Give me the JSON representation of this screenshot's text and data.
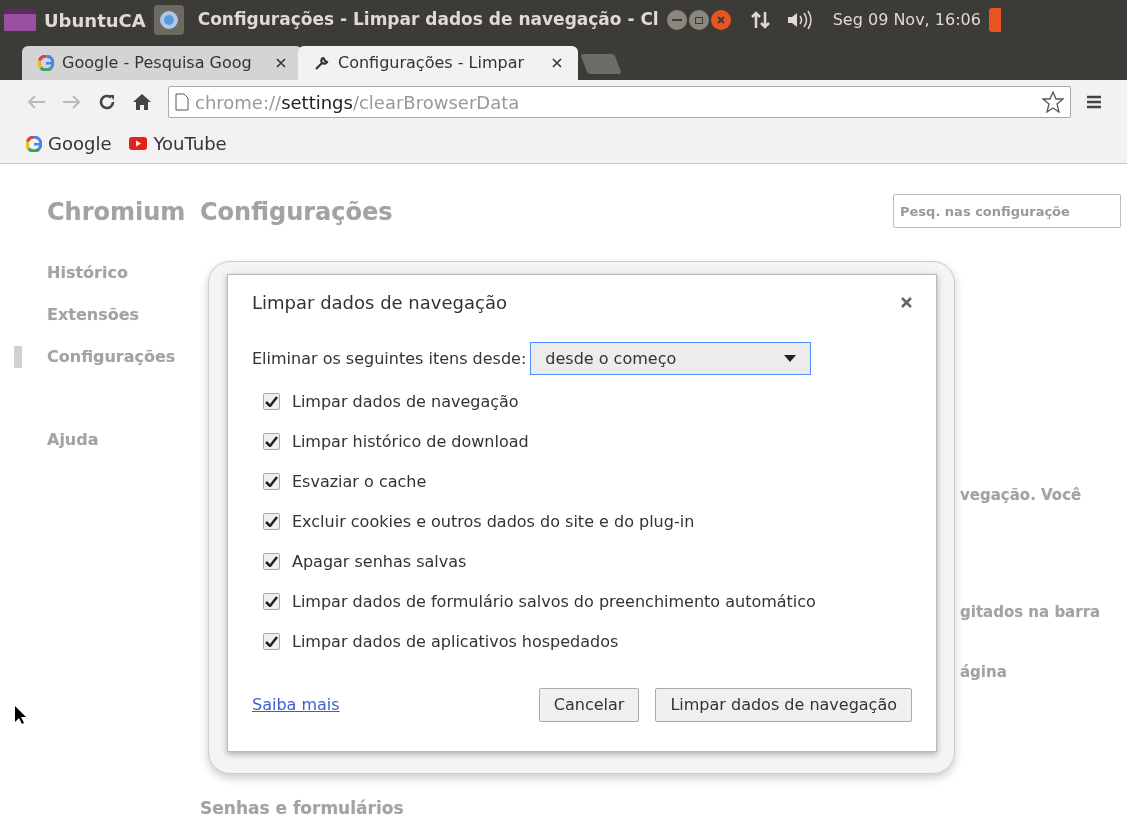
{
  "top_panel": {
    "app_name": "UbuntuCA",
    "window_title": "Configurações - Limpar dados de navegação - Cl",
    "clock": "Seg 09 Nov, 16:06"
  },
  "tabs": [
    {
      "label": "Google - Pesquisa Goog",
      "selected": false,
      "kind": "google"
    },
    {
      "label": "Configurações - Limpar",
      "selected": true,
      "kind": "settings"
    }
  ],
  "address_bar": {
    "scheme": "chrome://",
    "host": "settings",
    "path": "/clearBrowserData"
  },
  "bookmarks": [
    {
      "label": "Google",
      "kind": "google"
    },
    {
      "label": "YouTube",
      "kind": "youtube"
    }
  ],
  "sidebar": {
    "title": "Chromium",
    "items": [
      {
        "label": "Histórico",
        "selected": false
      },
      {
        "label": "Extensões",
        "selected": false
      },
      {
        "label": "Configurações",
        "selected": true
      }
    ],
    "help_item": "Ajuda"
  },
  "page": {
    "title": "Configurações",
    "search": {
      "placeholder": "Pesq. nas configuraçõe"
    },
    "fragments": [
      "vegação. Você",
      "gitados na barra",
      "ágina"
    ],
    "section_heading": "Senhas e formulários"
  },
  "dialog": {
    "title": "Limpar dados de navegação",
    "range_label": "Eliminar os seguintes itens desde:",
    "range_value": "desde o começo",
    "options": [
      {
        "label": "Limpar dados de navegação",
        "checked": true
      },
      {
        "label": "Limpar histórico de download",
        "checked": true
      },
      {
        "label": "Esvaziar o cache",
        "checked": true
      },
      {
        "label": "Excluir cookies e outros dados do site e do plug-in",
        "checked": true
      },
      {
        "label": "Apagar senhas salvas",
        "checked": true
      },
      {
        "label": "Limpar dados de formulário salvos do preenchimento automático",
        "checked": true
      },
      {
        "label": "Limpar dados de aplicativos hospedados",
        "checked": true
      }
    ],
    "learn_more": "Saiba mais",
    "buttons": [
      "Cancelar",
      "Limpar dados de navegação"
    ]
  }
}
